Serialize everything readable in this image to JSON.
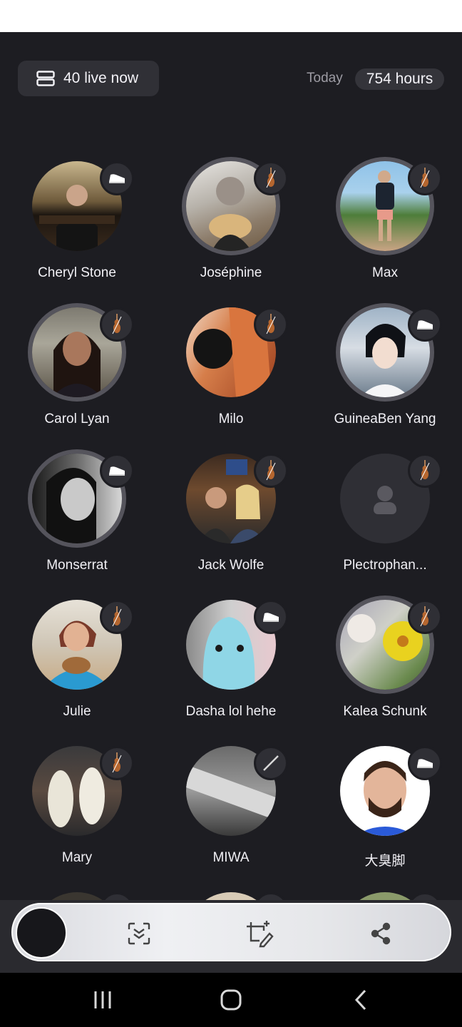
{
  "header": {
    "live_count_label": "40 live now",
    "today_label": "Today",
    "hours_label": "754 hours"
  },
  "users": [
    {
      "name": "Cheryl Stone",
      "instrument": "piano-icon"
    },
    {
      "name": "Joséphine",
      "instrument": "violin-icon"
    },
    {
      "name": "Max",
      "instrument": "violin-icon"
    },
    {
      "name": "Carol Lyan",
      "instrument": "violin-icon"
    },
    {
      "name": "Milo",
      "instrument": "violin-icon"
    },
    {
      "name": "GuineaBen Yang",
      "instrument": "piano-icon"
    },
    {
      "name": "Monserrat",
      "instrument": "piano-icon"
    },
    {
      "name": "Jack Wolfe",
      "instrument": "violin-icon"
    },
    {
      "name": "Plectrophan...",
      "instrument": "violin-icon"
    },
    {
      "name": "Julie",
      "instrument": "violin-icon"
    },
    {
      "name": "Dasha lol hehe",
      "instrument": "piano-icon"
    },
    {
      "name": "Kalea Schunk",
      "instrument": "violin-icon"
    },
    {
      "name": "Mary",
      "instrument": "violin-icon"
    },
    {
      "name": "MIWA",
      "instrument": "flute-icon"
    },
    {
      "name": "大臭脚",
      "instrument": "piano-icon"
    }
  ],
  "toolbar": {
    "icons": [
      "scan-icon",
      "edit-image-icon",
      "share-icon"
    ]
  },
  "navbar": {
    "icons": [
      "recent-apps-icon",
      "home-icon",
      "back-icon"
    ]
  }
}
